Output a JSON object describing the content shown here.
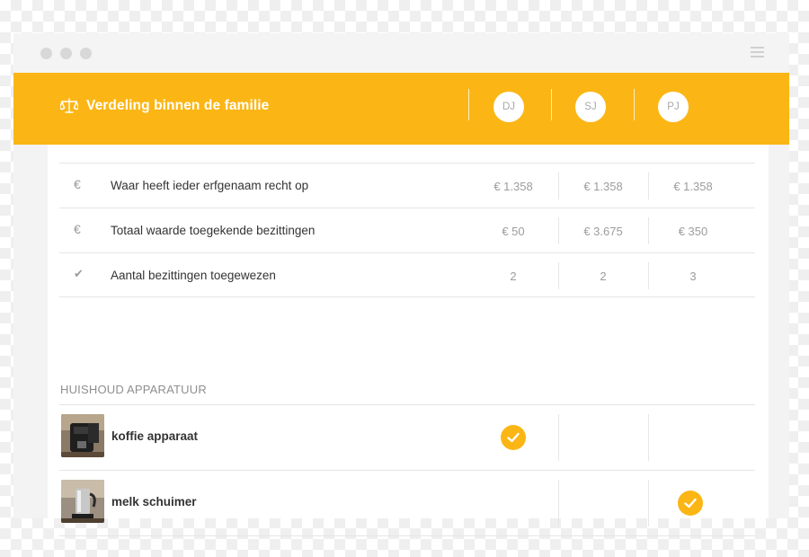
{
  "window": {
    "controls": [
      "close",
      "minimize",
      "maximize"
    ],
    "menu_icon": "hamburger-icon"
  },
  "header": {
    "icon": "scale-icon",
    "title": "Verdeling binnen de familie",
    "heirs": [
      "DJ",
      "SJ",
      "PJ"
    ],
    "accent_color": "#fbb615"
  },
  "summary": [
    {
      "icon": "euro-icon",
      "icon_glyph": "€",
      "label": "Waar heeft ieder erfgenaam recht op",
      "values": [
        "€ 1.358",
        "€ 1.358",
        "€ 1.358"
      ]
    },
    {
      "icon": "euro-icon",
      "icon_glyph": "€",
      "label": "Totaal waarde toegekende bezittingen",
      "values": [
        "€ 50",
        "€ 3.675",
        "€ 350"
      ]
    },
    {
      "icon": "check-icon",
      "icon_glyph": "✔",
      "label": "Aantal bezittingen toegewezen",
      "values": [
        "2",
        "2",
        "3"
      ]
    }
  ],
  "section": {
    "title": "HUISHOUD APPARATUUR",
    "items": [
      {
        "label": "koffie apparaat",
        "thumbnail": "coffee-machine-photo",
        "assigned_to": "DJ"
      },
      {
        "label": "melk schuimer",
        "thumbnail": "milk-frother-photo",
        "assigned_to": "PJ"
      }
    ]
  }
}
